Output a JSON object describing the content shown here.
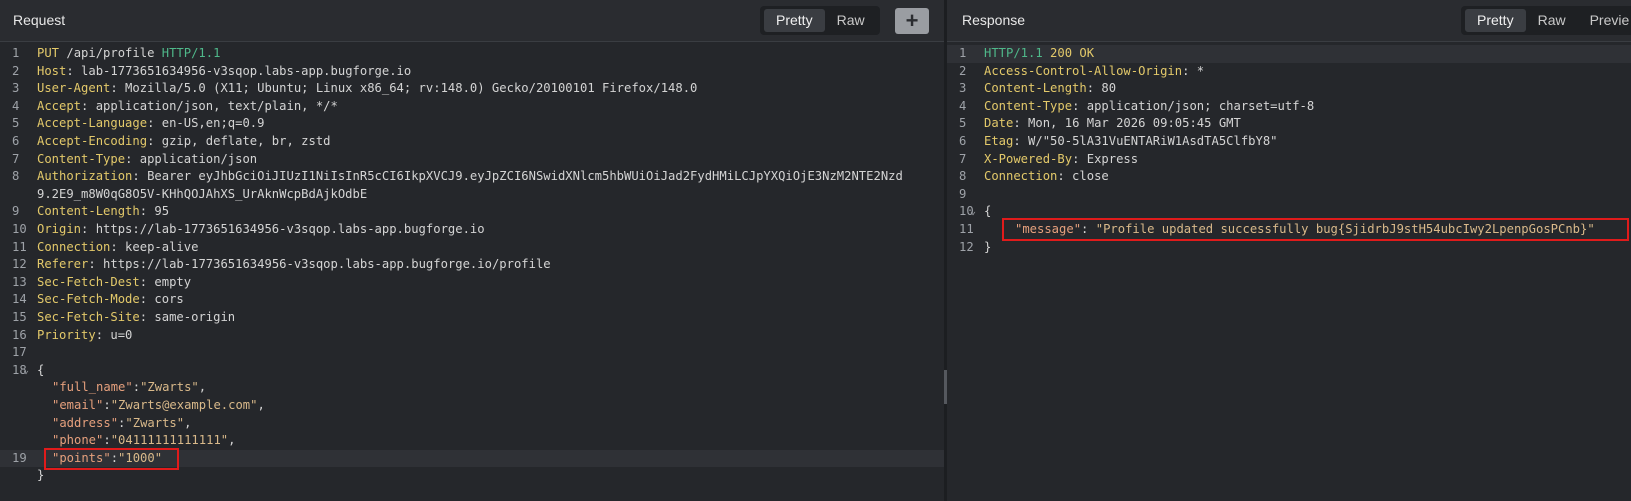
{
  "request": {
    "title": "Request",
    "view_toggle": {
      "pretty": "Pretty",
      "raw": "Raw"
    },
    "add_label": "+",
    "lines": [
      {
        "n": "1",
        "method": "PUT",
        "path": " /api/profile ",
        "proto": "HTTP/1.1"
      },
      {
        "n": "2",
        "name": "Host",
        "value": " lab-1773651634956-v3sqop.labs-app.bugforge.io"
      },
      {
        "n": "3",
        "name": "User-Agent",
        "value": " Mozilla/5.0 (X11; Ubuntu; Linux x86_64; rv:148.0) Gecko/20100101 Firefox/148.0"
      },
      {
        "n": "4",
        "name": "Accept",
        "value": " application/json, text/plain, */*"
      },
      {
        "n": "5",
        "name": "Accept-Language",
        "value": " en-US,en;q=0.9"
      },
      {
        "n": "6",
        "name": "Accept-Encoding",
        "value": " gzip, deflate, br, zstd"
      },
      {
        "n": "7",
        "name": "Content-Type",
        "value": " application/json"
      },
      {
        "n": "8",
        "name": "Authorization",
        "value": " Bearer eyJhbGciOiJIUzI1NiIsInR5cCI6IkpXVCJ9.eyJpZCI6NSwidXNlcm5hbWUiOiJad2FydHMiLCJpYXQiOjE3NzM2NTE2Nzd",
        "cont": "9.2E9_m8W0qG8O5V-KHhQOJAhXS_UrAknWcpBdAjkOdbE"
      },
      {
        "n": "9",
        "name": "Content-Length",
        "value": " 95"
      },
      {
        "n": "10",
        "name": "Origin",
        "value": " https://lab-1773651634956-v3sqop.labs-app.bugforge.io"
      },
      {
        "n": "11",
        "name": "Connection",
        "value": " keep-alive"
      },
      {
        "n": "12",
        "name": "Referer",
        "value": " https://lab-1773651634956-v3sqop.labs-app.bugforge.io/profile"
      },
      {
        "n": "13",
        "name": "Sec-Fetch-Dest",
        "value": " empty"
      },
      {
        "n": "14",
        "name": "Sec-Fetch-Mode",
        "value": " cors"
      },
      {
        "n": "15",
        "name": "Sec-Fetch-Site",
        "value": " same-origin"
      },
      {
        "n": "16",
        "name": "Priority",
        "value": " u=0"
      },
      {
        "n": "17"
      },
      {
        "n": "18",
        "fold": "⌄",
        "open": "{"
      }
    ],
    "body_fields": [
      {
        "key": "\"full_name\"",
        "sep": ":",
        "val": "\"Zwarts\"",
        "end": ","
      },
      {
        "key": "\"email\"",
        "sep": ":",
        "val": "\"Zwarts@example.com\"",
        "end": ","
      },
      {
        "key": "\"address\"",
        "sep": ":",
        "val": "\"Zwarts\"",
        "end": ","
      },
      {
        "key": "\"phone\"",
        "sep": ":",
        "val": "\"04111111111111\"",
        "end": ","
      }
    ],
    "points_line": {
      "n": "19",
      "key": "\"points\"",
      "sep": ":",
      "val": "\"1000\""
    },
    "close": "}"
  },
  "response": {
    "title": "Response",
    "view_toggle": {
      "pretty": "Pretty",
      "raw": "Raw",
      "preview": "Previe"
    },
    "status": {
      "n": "1",
      "proto": "HTTP/1.1",
      "code": " 200 ",
      "text": "OK"
    },
    "headers": [
      {
        "n": "2",
        "name": "Access-Control-Allow-Origin",
        "value": " *"
      },
      {
        "n": "3",
        "name": "Content-Length",
        "value": " 80"
      },
      {
        "n": "4",
        "name": "Content-Type",
        "value": " application/json; charset=utf-8"
      },
      {
        "n": "5",
        "name": "Date",
        "value": " Mon, 16 Mar 2026 09:05:45 GMT"
      },
      {
        "n": "6",
        "name": "Etag",
        "value": " W/\"50-5lA31VuENTARiW1AsdTA5ClfbY8\""
      },
      {
        "n": "7",
        "name": "X-Powered-By",
        "value": " Express"
      },
      {
        "n": "8",
        "name": "Connection",
        "value": " close"
      }
    ],
    "blank_n": "9",
    "open": {
      "n": "10",
      "fold": "⌄",
      "text": "{"
    },
    "message": {
      "n": "11",
      "key": "\"message\"",
      "sep": ": ",
      "val": "\"Profile updated successfully bug{SjidrbJ9stH54ubcIwy2LpenpGosPCnb}\""
    },
    "close": {
      "n": "12",
      "text": "}"
    }
  }
}
